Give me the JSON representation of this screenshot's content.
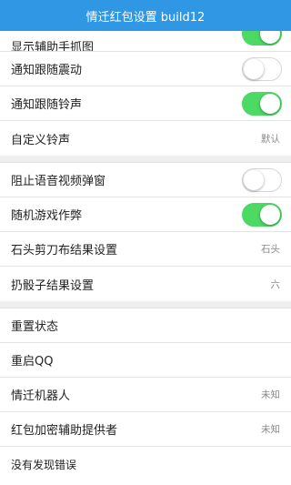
{
  "title": "情迁红包设置 build12",
  "colors": {
    "titlebar": "#2f97e4",
    "toggle_on": "#4cd964",
    "section_gap": "#efefef"
  },
  "rows": {
    "r0": {
      "label": "显示辅助手抓图",
      "toggle": "on"
    },
    "r1": {
      "label": "通知跟随震动",
      "toggle": "off"
    },
    "r2": {
      "label": "通知跟随铃声",
      "toggle": "on"
    },
    "r3": {
      "label": "自定义铃声",
      "value": "默认"
    },
    "r4": {
      "label": "阻止语音视频弹窗",
      "toggle": "off"
    },
    "r5": {
      "label": "随机游戏作弊",
      "toggle": "on"
    },
    "r6": {
      "label": "石头剪刀布结果设置",
      "value": "石头"
    },
    "r7": {
      "label": "扔骰子结果设置",
      "value": "六"
    },
    "r8": {
      "label": "重置状态"
    },
    "r9": {
      "label": "重启QQ"
    },
    "r10": {
      "label": "情迁机器人",
      "value": "未知"
    },
    "r11": {
      "label": "红包加密辅助提供者",
      "value": "未知"
    },
    "r12": {
      "label": "没有发现错误"
    }
  }
}
